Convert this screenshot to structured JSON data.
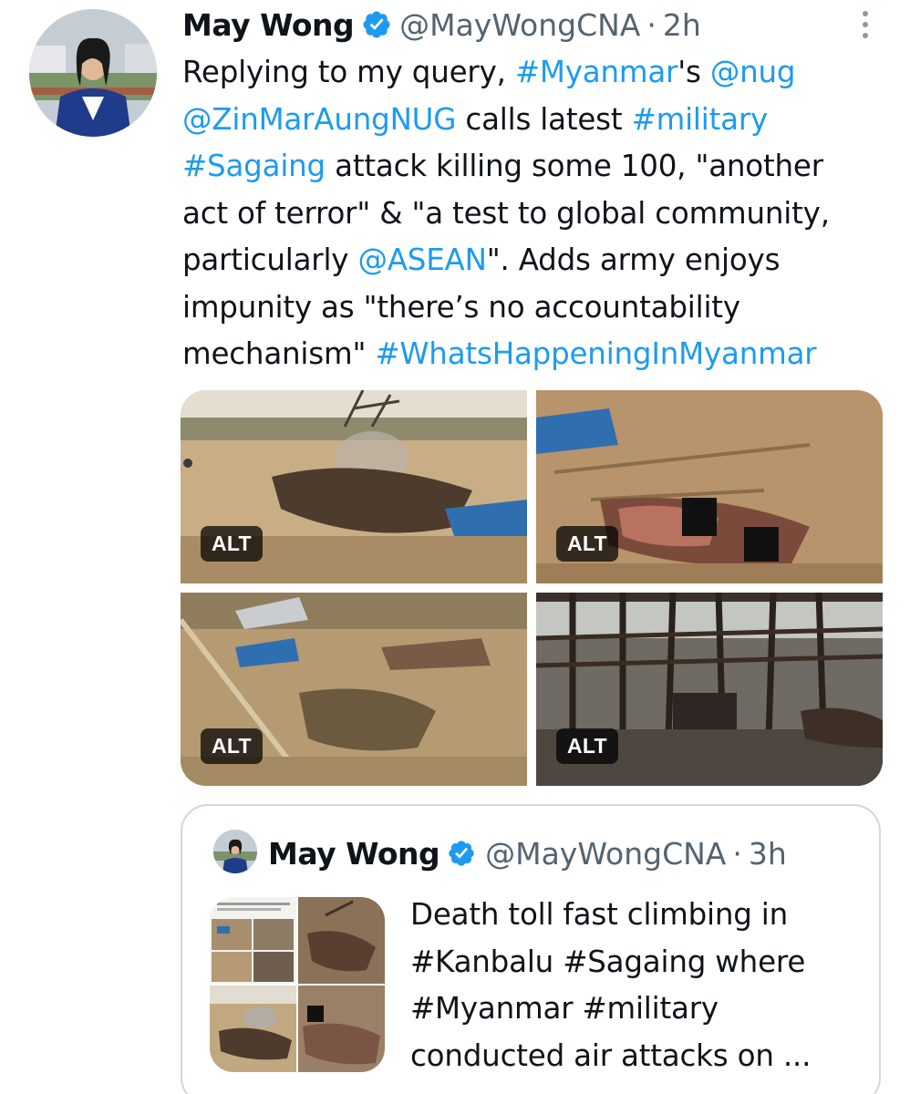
{
  "tweet": {
    "display_name": "May Wong",
    "handle": "@MayWongCNA",
    "separator": "·",
    "time": "2h",
    "verified_icon": "verified-badge-icon",
    "more_icon": "more-vertical-icon",
    "lines": [
      [
        {
          "t": "Replying to my query, "
        },
        {
          "t": "#Myanmar",
          "link": true
        },
        {
          "t": "'s "
        },
        {
          "t": "@nug",
          "link": true
        }
      ],
      [
        {
          "t": "@ZinMarAungNUG",
          "link": true
        },
        {
          "t": " calls latest "
        },
        {
          "t": "#military",
          "link": true
        }
      ],
      [
        {
          "t": "#Sagaing",
          "link": true
        },
        {
          "t": " attack killing some 100, \"another"
        }
      ],
      [
        {
          "t": "act of terror\" & \"a test to global community,"
        }
      ],
      [
        {
          "t": "particularly "
        },
        {
          "t": "@ASEAN",
          "link": true
        },
        {
          "t": "\". Adds army enjoys"
        }
      ],
      [
        {
          "t": "impunity as \"there’s no accountability"
        }
      ],
      [
        {
          "t": "mechanism\" "
        },
        {
          "t": "#WhatsHappeningInMyanmar",
          "link": true
        }
      ]
    ],
    "media": [
      {
        "alt_label": "ALT"
      },
      {
        "alt_label": "ALT"
      },
      {
        "alt_label": "ALT"
      },
      {
        "alt_label": "ALT"
      }
    ]
  },
  "quoted_tweet": {
    "display_name": "May Wong",
    "handle": "@MayWongCNA",
    "separator": "·",
    "time": "3h",
    "lines": [
      "Death toll fast climbing in",
      "#Kanbalu #Sagaing where",
      "#Myanmar #military",
      "conducted air attacks on ..."
    ]
  },
  "colors": {
    "link": "#1d9bf0",
    "text": "#0f1419",
    "secondary": "#536471",
    "border": "#cfd9de"
  }
}
